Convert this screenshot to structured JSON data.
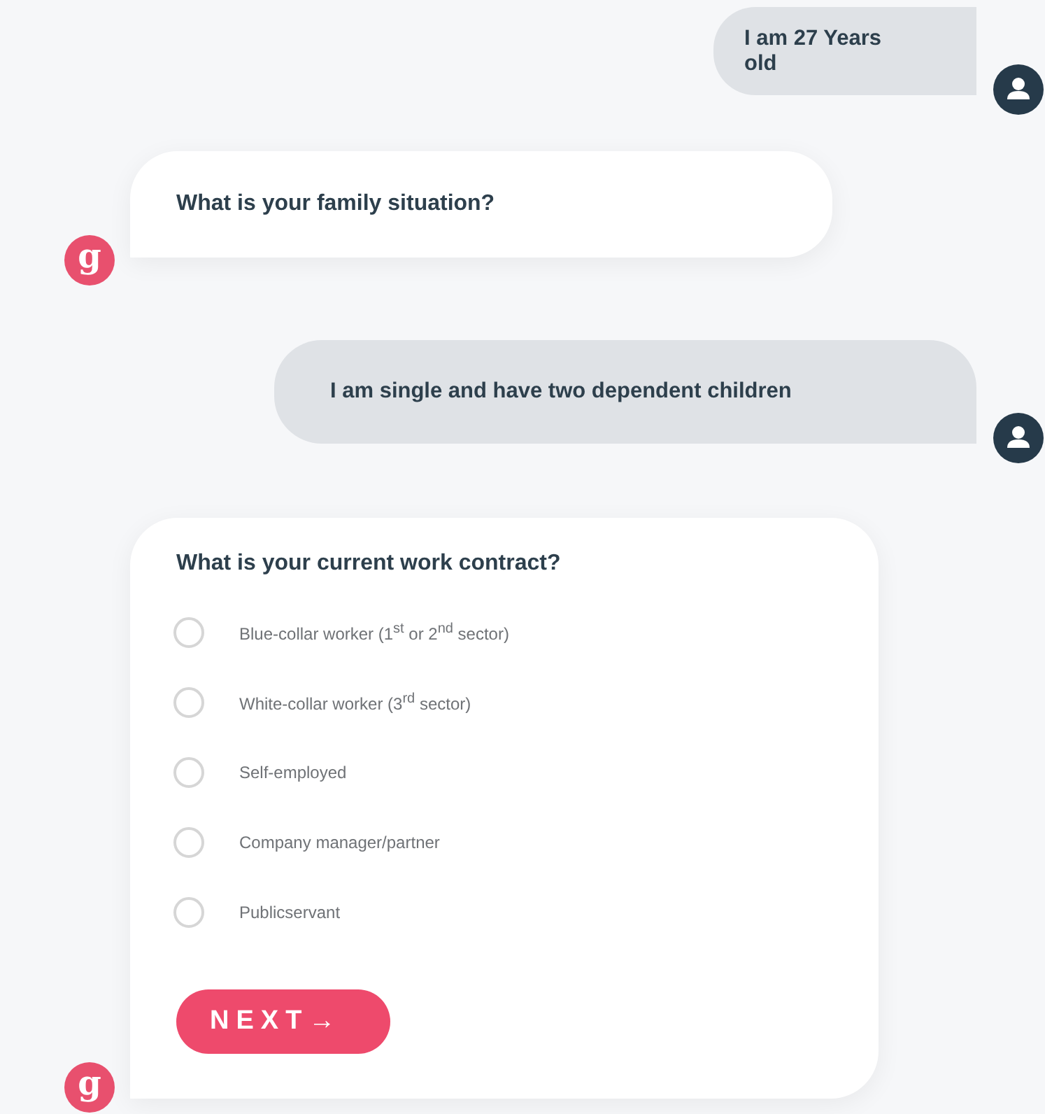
{
  "messages": [
    {
      "kind": "user",
      "text": "I am 27 Years old"
    },
    {
      "kind": "bot",
      "avatar": "g",
      "text": "What is your family situation?"
    },
    {
      "kind": "user",
      "text": "I am single and have two dependent children"
    },
    {
      "kind": "form",
      "avatar": "g",
      "text": "What is your current work contract?",
      "options": [
        {
          "label": "Blue-collar worker (1$^{st}$ or 2$^{nd}$ sector)",
          "selected": false
        },
        {
          "label": "White-collar worker (3$^{rd}$ sector)",
          "selected": false
        },
        {
          "label": "Self-employed",
          "selected": false
        },
        {
          "label": "Company manager/partner",
          "selected": false
        },
        {
          "label": "Publicservant",
          "selected": false
        }
      ],
      "button": "NEXT→"
    }
  ]
}
